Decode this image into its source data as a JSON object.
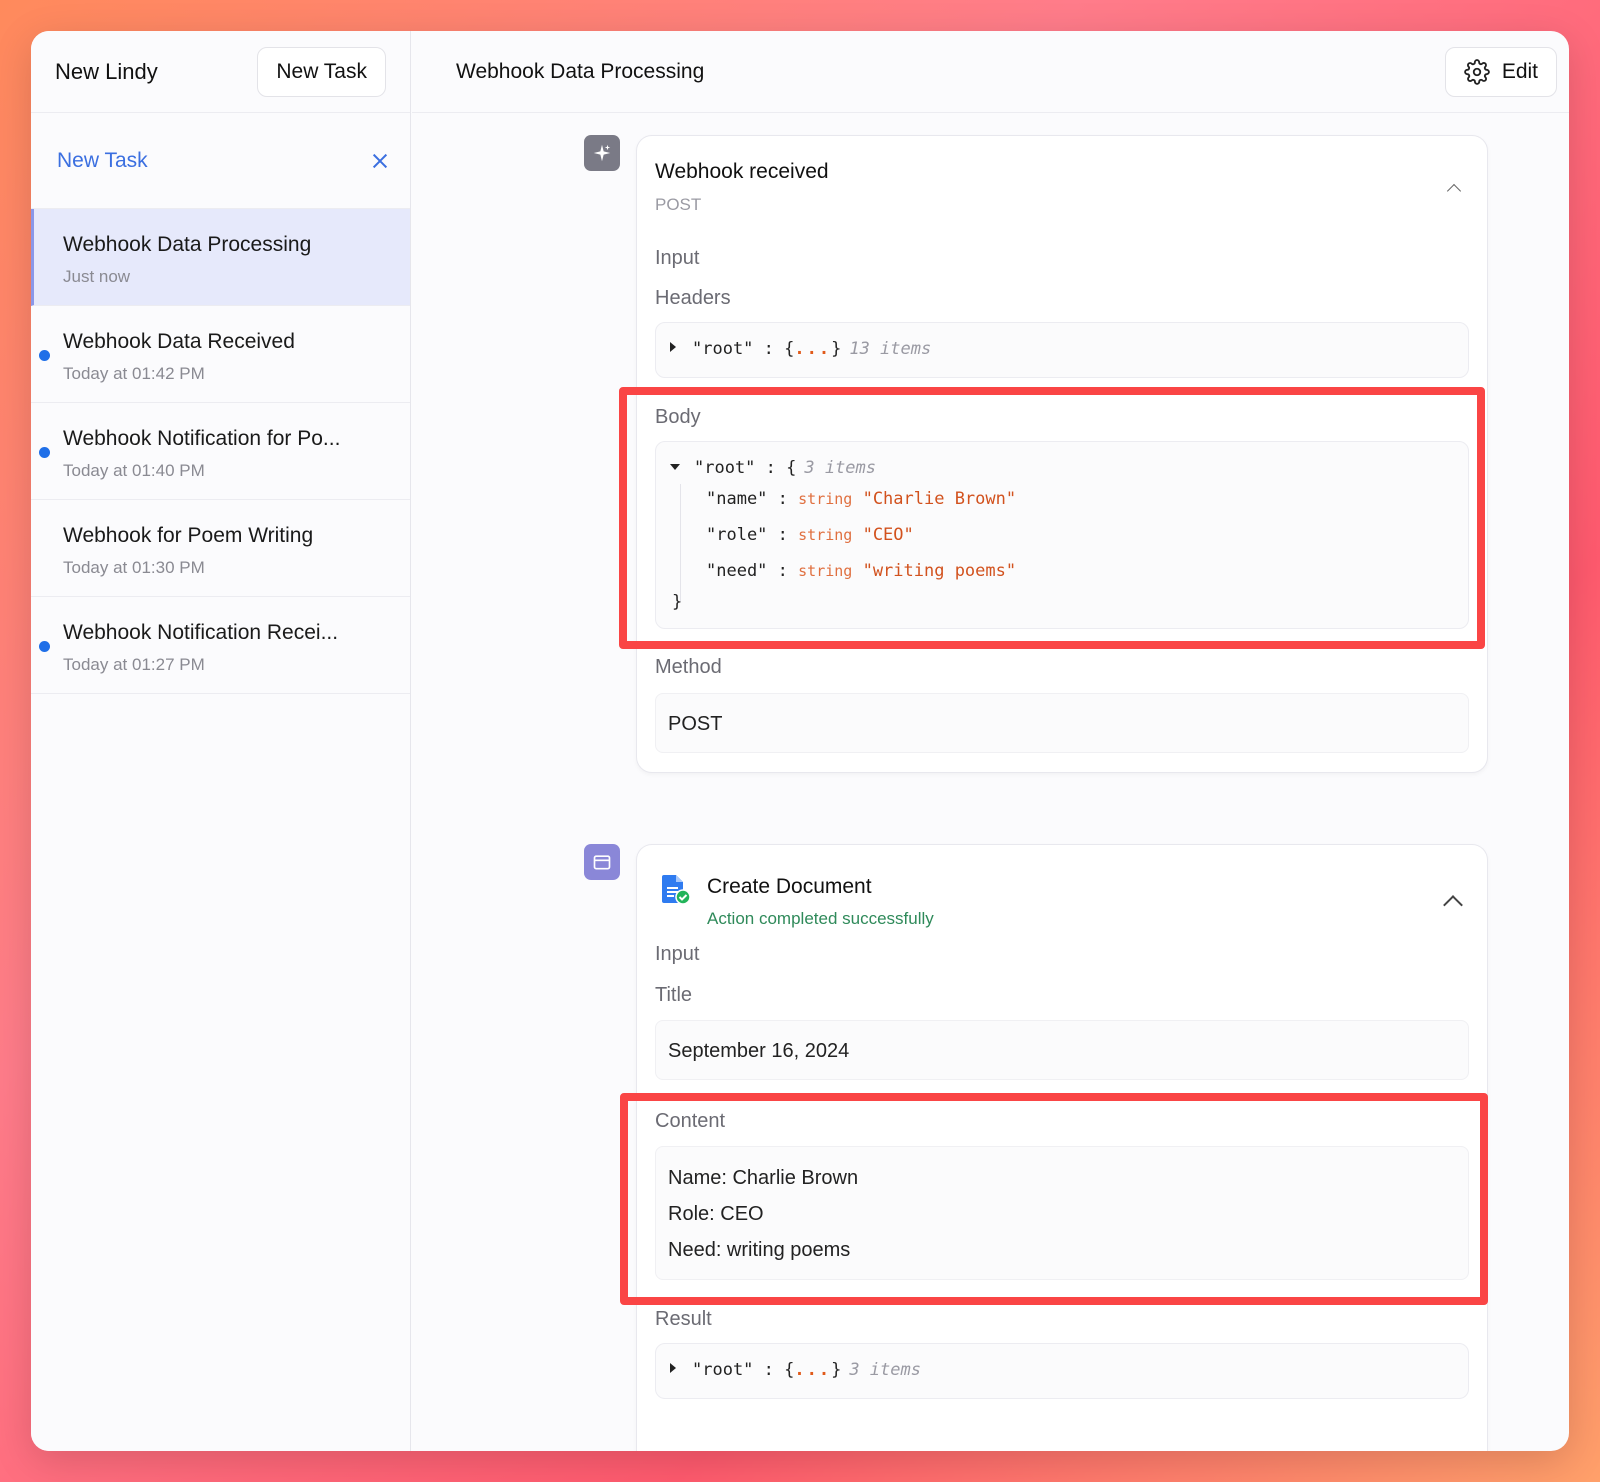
{
  "sidebar": {
    "title": "New Lindy",
    "new_task_button": "New Task",
    "new_task_row_label": "New Task",
    "tasks": [
      {
        "title": "Webhook Data Processing",
        "time": "Just now"
      },
      {
        "title": "Webhook Data Received",
        "time": "Today at 01:42 PM"
      },
      {
        "title": "Webhook Notification for Po...",
        "time": "Today at 01:40 PM"
      },
      {
        "title": "Webhook for Poem Writing",
        "time": "Today at 01:30 PM"
      },
      {
        "title": "Webhook Notification Recei...",
        "time": "Today at 01:27 PM"
      }
    ]
  },
  "header": {
    "title": "Webhook Data Processing",
    "edit_label": "Edit"
  },
  "webhook_card": {
    "title": "Webhook received",
    "subtitle": "POST",
    "input_label": "Input",
    "headers_label": "Headers",
    "headers_root": "\"root\" : {",
    "headers_dots": "...",
    "headers_close": "}",
    "headers_count": "13 items",
    "body_label": "Body",
    "body_root": "\"root\" : {",
    "body_count": "3 items",
    "body_fields": [
      {
        "key": "\"name\" :",
        "type": "string",
        "value": "\"Charlie Brown\""
      },
      {
        "key": "\"role\" :",
        "type": "string",
        "value": "\"CEO\""
      },
      {
        "key": "\"need\" :",
        "type": "string",
        "value": "\"writing poems\""
      }
    ],
    "body_close": "}",
    "method_label": "Method",
    "method_value": "POST"
  },
  "document_card": {
    "title": "Create Document",
    "status": "Action completed successfully",
    "input_label": "Input",
    "title_label": "Title",
    "title_value": "September 16, 2024",
    "content_label": "Content",
    "content_lines": [
      "Name: Charlie Brown",
      "Role: CEO",
      "Need: writing poems"
    ],
    "result_label": "Result",
    "result_root": "\"root\" : {",
    "result_dots": "...",
    "result_close": "}",
    "result_count": "3 items"
  },
  "colors": {
    "accent_blue": "#3b6fe0",
    "unread_dot": "#1f6fe8",
    "success_green": "#2f8a5a",
    "highlight_red": "#fa4545"
  }
}
